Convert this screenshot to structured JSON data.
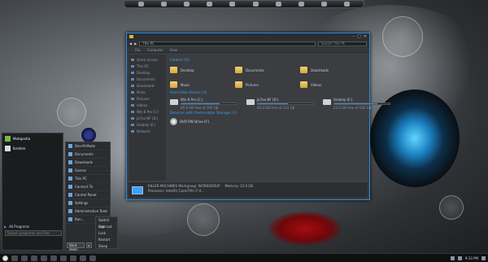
{
  "explorer": {
    "address": "This PC",
    "search_placeholder": "Search This PC",
    "ribbon": [
      "File",
      "Computer",
      "View"
    ],
    "nav_items": [
      "Quick access",
      "This PC",
      "Desktop",
      "Documents",
      "Downloads",
      "Music",
      "Pictures",
      "Videos",
      "Win 8 Pro (C:)",
      "Ja7oo NF (D:)",
      "Globaly (E:)",
      "Network"
    ],
    "folders_header": "Folders (6)",
    "folders": [
      "Desktop",
      "Documents",
      "Downloads",
      "Music",
      "Pictures",
      "Videos"
    ],
    "drives_header": "Hard Disk Drives (3)",
    "drives": [
      {
        "name": "Win 8 Pro (C:)",
        "free": "60.8 GB free of 195 GB",
        "used_fraction": 0.69
      },
      {
        "name": "Ja7oo NF (D:)",
        "free": "60.0 GB free of 133 GB",
        "used_fraction": 0.55
      },
      {
        "name": "Globaly (E:)",
        "free": "23.5 GB free of 106 GB",
        "used_fraction": 0.78
      }
    ],
    "removable_header": "Devices with Removable Storage (1)",
    "removable": [
      "DVD RW Drive (F:)"
    ],
    "details": {
      "line1": "KILLER-MACHINES  Workgroup:  WORKGROUP",
      "line2": "Processor:  Intel(R) Core(TM) i7-4...",
      "memory": "Memory:  12.0 GB"
    }
  },
  "start_menu": {
    "user": "Metapedia",
    "user2": "Ibrahim",
    "all_programs": "All Programs",
    "search_placeholder": "Search programs and files",
    "right_items": [
      "Dev-M-Mode",
      "Documents",
      "Downloads",
      "Games",
      "This PC",
      "Connect To",
      "Control Panel",
      "Settings",
      "Administrative Tools",
      "Run..."
    ],
    "power_label": "Shut down",
    "flyout": [
      "Switch user",
      "Sign out",
      "Lock",
      "Restart",
      "Sleep"
    ]
  },
  "taskbar": {
    "clock": "9:33 PM"
  }
}
